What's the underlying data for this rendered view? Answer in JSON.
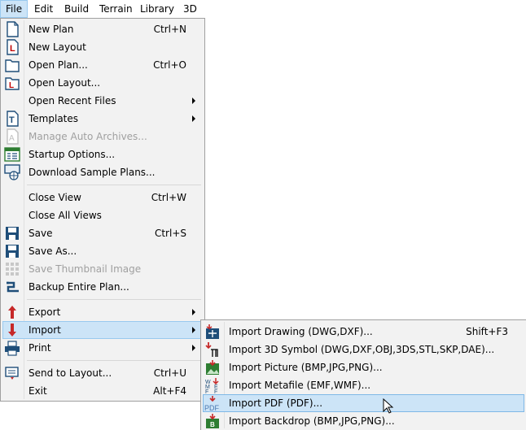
{
  "menubar": {
    "items": [
      "File",
      "Edit",
      "Build",
      "Terrain",
      "Library",
      "3D"
    ]
  },
  "file_menu": {
    "items": [
      {
        "label": "New Plan",
        "shortcut": "Ctrl+N",
        "icon": "new-plan-icon"
      },
      {
        "label": "New Layout",
        "shortcut": "",
        "icon": "new-layout-icon"
      },
      {
        "label": "Open Plan...",
        "shortcut": "Ctrl+O",
        "icon": "open-plan-icon"
      },
      {
        "label": "Open Layout...",
        "shortcut": "",
        "icon": "open-layout-icon"
      },
      {
        "label": "Open Recent Files",
        "shortcut": "",
        "icon": ""
      },
      {
        "label": "Templates",
        "shortcut": "",
        "icon": "templates-icon"
      },
      {
        "label": "Manage Auto Archives...",
        "shortcut": "",
        "icon": "archives-icon"
      },
      {
        "label": "Startup Options...",
        "shortcut": "",
        "icon": "startup-options-icon"
      },
      {
        "label": "Download Sample Plans...",
        "shortcut": "",
        "icon": "download-plans-icon"
      },
      {
        "label": "Close View",
        "shortcut": "Ctrl+W",
        "icon": ""
      },
      {
        "label": "Close All Views",
        "shortcut": "",
        "icon": ""
      },
      {
        "label": "Save",
        "shortcut": "Ctrl+S",
        "icon": "save-icon"
      },
      {
        "label": "Save As...",
        "shortcut": "",
        "icon": "save-as-icon"
      },
      {
        "label": "Save Thumbnail Image",
        "shortcut": "",
        "icon": "thumbnail-icon"
      },
      {
        "label": "Backup Entire Plan...",
        "shortcut": "",
        "icon": "backup-icon"
      },
      {
        "label": "Export",
        "shortcut": "",
        "icon": "export-icon"
      },
      {
        "label": "Import",
        "shortcut": "",
        "icon": "import-icon"
      },
      {
        "label": "Print",
        "shortcut": "",
        "icon": "print-icon"
      },
      {
        "label": "Send to Layout...",
        "shortcut": "Ctrl+U",
        "icon": "send-to-layout-icon"
      },
      {
        "label": "Exit",
        "shortcut": "Alt+F4",
        "icon": ""
      }
    ]
  },
  "import_menu": {
    "items": [
      {
        "label": "Import Drawing (DWG,DXF)...",
        "shortcut": "Shift+F3",
        "icon": "import-drawing-icon"
      },
      {
        "label": "Import 3D Symbol (DWG,DXF,OBJ,3DS,STL,SKP,DAE)...",
        "shortcut": "",
        "icon": "import-3d-symbol-icon"
      },
      {
        "label": "Import Picture (BMP,JPG,PNG)...",
        "shortcut": "",
        "icon": "import-picture-icon"
      },
      {
        "label": "Import Metafile (EMF,WMF)...",
        "shortcut": "",
        "icon": "import-metafile-icon"
      },
      {
        "label": "Import PDF (PDF)...",
        "shortcut": "",
        "icon": "import-pdf-icon"
      },
      {
        "label": "Import Backdrop (BMP,JPG,PNG)...",
        "shortcut": "",
        "icon": "import-backdrop-icon"
      }
    ]
  },
  "icon_text": {
    "wmf": "W M F",
    "pdf": "PDF",
    "templates": "T",
    "layout": "L"
  },
  "colors": {
    "highlight": "#cce4f7",
    "highlight_border": "#99c9ef",
    "menu_bg": "#f2f2f2",
    "disabled": "#a0a0a0"
  }
}
